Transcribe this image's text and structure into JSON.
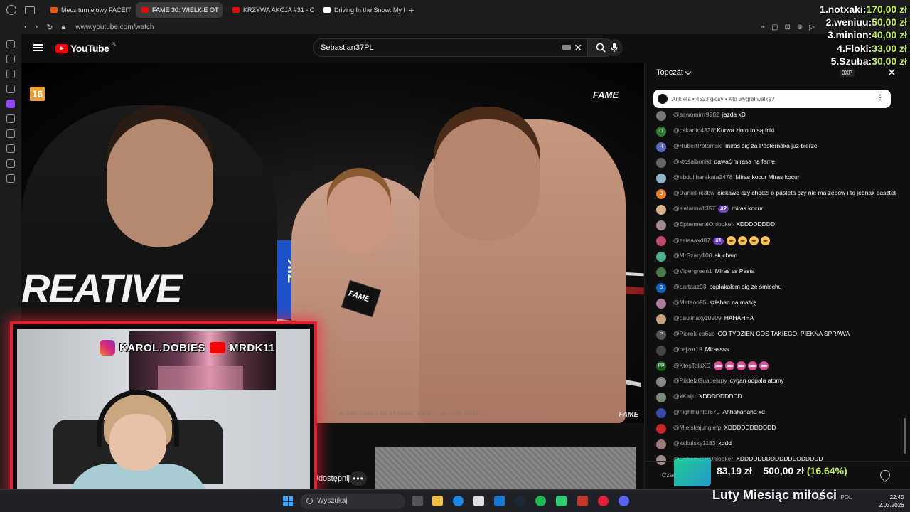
{
  "browser": {
    "tabs": [
      {
        "label": "Mecz turniejowy FACEIT - ",
        "favicon_color": "#ff5500",
        "active": false
      },
      {
        "label": "FAME 30: WIELKIE OT",
        "favicon_color": "#ff0000",
        "active": true
      },
      {
        "label": "KRZYWA AKCJA #31 - CZ",
        "favicon_color": "#ff0000",
        "active": false
      },
      {
        "label": "Driving In the Snow: My Li",
        "favicon_color": "#ffffff",
        "active": false
      }
    ],
    "new_tab_label": "+",
    "url": "www.youtube.com/watch"
  },
  "youtube": {
    "logo_text": "YouTube",
    "region": "PL",
    "search_value": "Sebastian37PL",
    "age_rating": "16",
    "fame_logo": "FAME",
    "shirt_text": "REATIVE",
    "mic_text": "FAME",
    "corner_text": "ZIK",
    "video_watermark": "...W ZAKŁADACH NA STRONIE: WWW....  HAZARD MOŻE...",
    "share_label": "Udostępnij",
    "more_label": "•••"
  },
  "webcam": {
    "instagram_handle": "KAROL.DOBIES",
    "youtube_handle": "MRDK11"
  },
  "chat": {
    "header_label": "Topczat",
    "xp_label": "0XP",
    "poll_text": "Ankieta • 4523 głosy • Kto wygrał walkę?",
    "messages": [
      {
        "user": "@sawomirrr9902",
        "text": "jazda xD",
        "avatar": "#777777",
        "initial": ""
      },
      {
        "user": "@oskarito4328",
        "text": "Kurwa złoto to są friki",
        "avatar": "#2e7d32",
        "initial": "O"
      },
      {
        "user": "@HubertPotomski",
        "text": "miras się za Pasternaka już bierze",
        "avatar": "#5c6bc0",
        "initial": "H"
      },
      {
        "user": "@ktośalbonikt",
        "text": "dawać mirasa na fame",
        "avatar": "#666666",
        "initial": ""
      },
      {
        "user": "@abdullharakata2478",
        "text": "Miras kocur Miras kocur",
        "avatar": "#8fb3c8",
        "initial": ""
      },
      {
        "user": "@Daniel-rc3bw",
        "text": "ciekawe czy chodzi o pasteta czy nie ma zębów i to jednak pasztet",
        "avatar": "#e67e22",
        "initial": "D"
      },
      {
        "user": "@Katarina1357",
        "badge": "#2",
        "text": "miras kocur",
        "avatar": "#d9b38c",
        "initial": ""
      },
      {
        "user": "@EphemeralOnlooker",
        "text": "XDDDDDDDD",
        "avatar": "#9e8c8c",
        "initial": ""
      },
      {
        "user": "@asiaaaxd87",
        "badge": "#1",
        "text": "",
        "emojis": "lol",
        "emoji_count": 4,
        "avatar": "#c04a6a",
        "initial": ""
      },
      {
        "user": "@MrSzary100",
        "text": "słucham",
        "avatar": "#4caf8a",
        "initial": ""
      },
      {
        "user": "@Vipergreen1",
        "text": "Miras vs Pasta",
        "avatar": "#4a7a4a",
        "initial": ""
      },
      {
        "user": "@bartaaz93",
        "text": "poplakałem się ze śmiechu",
        "avatar": "#1565c0",
        "initial": "B"
      },
      {
        "user": "@Mateoo95",
        "text": "szłaban na matkę",
        "avatar": "#b07a9a",
        "initial": ""
      },
      {
        "user": "@paulinaxyz0909",
        "text": "HAHAHHA",
        "avatar": "#c8a27a",
        "initial": ""
      },
      {
        "user": "@Piorek-cb6uo",
        "text": "CO TYDZIEN COS TAKIEGO, PIEKNA SPRAWA",
        "avatar": "#555555",
        "initial": "P"
      },
      {
        "user": "@cejzor19",
        "text": "Mirassss",
        "avatar": "#444444",
        "initial": ""
      },
      {
        "user": "@KtosTakiXD",
        "text": "",
        "emojis": "lips",
        "emoji_count": 5,
        "avatar": "#1b5e20",
        "initial": "PP"
      },
      {
        "user": "@PüdelzGuadelupy",
        "text": "cygan odpala atomy",
        "avatar": "#888888",
        "initial": ""
      },
      {
        "user": "@xKaiju",
        "text": "XDDDDDDDDD",
        "avatar": "#7a8a7a",
        "initial": ""
      },
      {
        "user": "@nighthunter679",
        "text": "Ahhahahaha xd",
        "avatar": "#3949ab",
        "initial": ""
      },
      {
        "user": "@Miejskajunglefp",
        "text": "XDDDDDDDDDDD",
        "avatar": "#c62828",
        "initial": ""
      },
      {
        "user": "@kakulsky1183",
        "text": "xddd",
        "avatar": "#9a7a7a",
        "initial": ""
      },
      {
        "user": "@EphemeralOnlooker",
        "text": "XDDDDDDDDDDDDDDDDDDD",
        "avatar": "#9e8c8c",
        "initial": ""
      }
    ],
    "footer_label": "Czat"
  },
  "donations": {
    "top": [
      {
        "name": "1.notxaki:",
        "amount": "170,00 zł"
      },
      {
        "name": "2.weniuu:",
        "amount": "50,00 zł"
      },
      {
        "name": "3.minion:",
        "amount": "40,00 zł"
      },
      {
        "name": "4.Floki:",
        "amount": "33,00 zł"
      },
      {
        "name": "5.Szuba:",
        "amount": "30,00 zł"
      }
    ],
    "goal_current": "83,19 zł",
    "goal_target": "500,00 zł",
    "goal_percent": "(16.64%)",
    "goal_title": "Luty Miesiąc miłości"
  },
  "taskbar": {
    "search_label": "Wyszukaj",
    "lang": "POL",
    "time": "22:40",
    "date": "2.03.2026"
  }
}
